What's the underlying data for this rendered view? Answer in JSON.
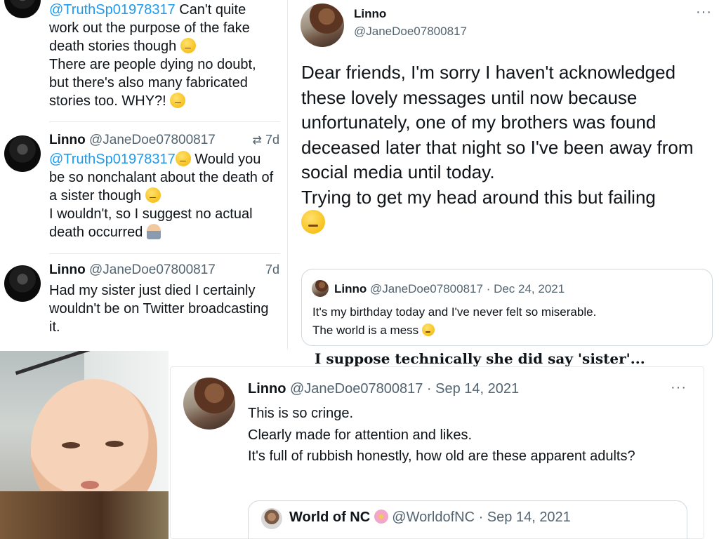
{
  "left_column": {
    "tweet1": {
      "mention": "@TruthSp01978317",
      "lines": [
        " Can't quite work out the purpose of the fake death stories though ",
        "There are people dying no doubt, but there's also many fabricated stories too. WHY?! "
      ],
      "emojis": [
        "thinking-emoji",
        "monocle-emoji"
      ]
    },
    "tweet2": {
      "name": "Linno",
      "handle": "@JaneDoe07800817",
      "time": "7d",
      "mention": "@TruthSp01978317",
      "line1": " Would you be so nonchalant about the death of a sister though ",
      "line2": "I wouldn't, so I suggest no actual death occurred ",
      "emojis": [
        "grinning-squint-emoji",
        "thinking-emoji",
        "shrug-emoji"
      ]
    },
    "tweet3": {
      "name": "Linno",
      "handle": "@JaneDoe07800817",
      "time": "7d",
      "text": "Had my sister just died I certainly wouldn't be on Twitter broadcasting it."
    }
  },
  "right_card": {
    "name": "Linno",
    "handle": "@JaneDoe07800817",
    "more_label": "···",
    "body_line1": "Dear friends, I'm sorry I haven't acknowledged these lovely messages until now because unfortunately, one of my brothers was found deceased later that night so I've been away from social media until today.",
    "body_line2": "Trying to get my head around this but failing",
    "emoji": "crying-emoji",
    "quote": {
      "name": "Linno",
      "handle": "@JaneDoe07800817",
      "date": "· Dec 24, 2021",
      "line1": "It's my birthday today and I've never felt so miserable.",
      "line2": "The world is a mess ",
      "emoji": "relieved-emoji"
    }
  },
  "caption": "I suppose technically she did say 'sister'...",
  "bottom_card": {
    "name": "Linno",
    "handle": "@JaneDoe07800817",
    "date": "· Sep 14, 2021",
    "more_label": "···",
    "lines": [
      "This is so cringe.",
      "Clearly made for attention and likes.",
      "It's full of rubbish honestly, how old are these apparent adults?"
    ],
    "quote": {
      "name": "World of NC",
      "handle": "@WorldofNC",
      "date": "· Sep 14, 2021",
      "emoji": "cherry-blossom-emoji"
    }
  }
}
